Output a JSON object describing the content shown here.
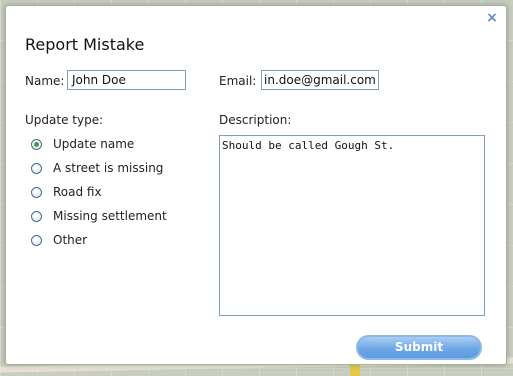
{
  "dialog": {
    "title": "Report Mistake",
    "close_label": "×",
    "name_label": "Name:",
    "name_value": "John Doe",
    "email_label": "Email:",
    "email_value": "in.doe@gmail.com",
    "update_type_label": "Update type:",
    "update_types": [
      {
        "label": "Update name",
        "checked": true
      },
      {
        "label": "A street is missing",
        "checked": false
      },
      {
        "label": "Road fix",
        "checked": false
      },
      {
        "label": "Missing settlement",
        "checked": false
      },
      {
        "label": "Other",
        "checked": false
      }
    ],
    "description_label": "Description:",
    "description_value": "Should be called Gough St.",
    "submit_label": "Submit"
  },
  "colors": {
    "accent": "#5c9ae0",
    "field_border": "#7f9db9",
    "radio_checked": "#3f9d3f"
  }
}
